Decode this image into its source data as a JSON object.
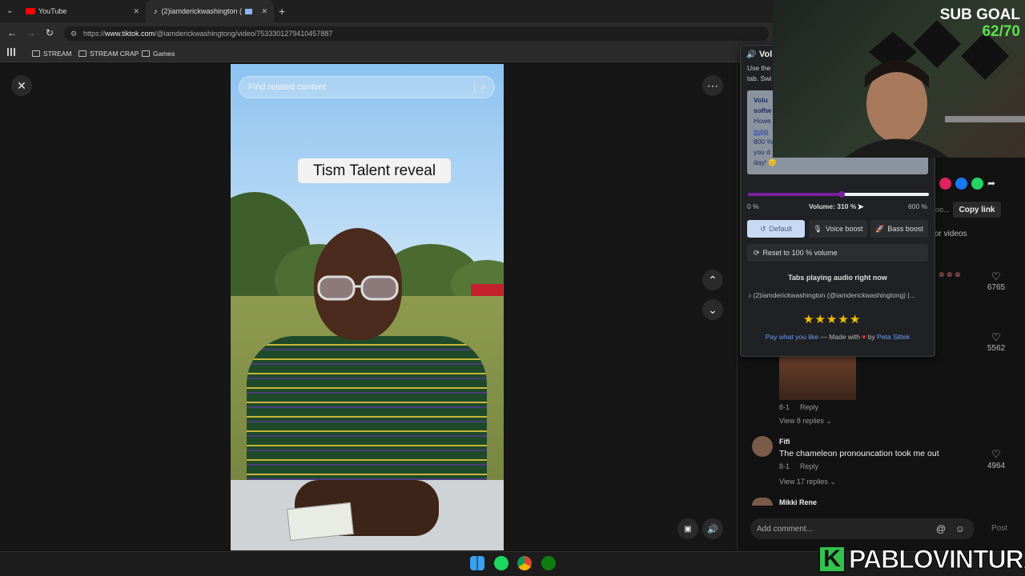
{
  "browser": {
    "tabs": [
      {
        "title": "YouTube"
      },
      {
        "title": "(2)iamderickwashington (@"
      }
    ],
    "url_prefix": "https://",
    "url_domain": "www.tiktok.com",
    "url_path": "/@iamderickwashingtong/video/7533301279410457887",
    "bookmarks": [
      "STREAM",
      "STREAM CRAP",
      "Games"
    ]
  },
  "video": {
    "search_placeholder": "Find related content",
    "caption": "Tism Talent reveal"
  },
  "volume_popup": {
    "title": "Vol",
    "intro_line1": "Use the",
    "intro_line2": "tab. Swi",
    "notice_lines": [
      "Volu",
      "softw",
      "Howe",
      "supp",
      "800 %",
      "you d",
      "day! 😊"
    ],
    "level_min": "0 %",
    "level_max": "600 %",
    "volume_label": "Volume: 310 %",
    "volume_value_pct": 310,
    "volume_max_pct": 600,
    "buttons": {
      "default": "Default",
      "voice": "Voice boost",
      "bass": "Bass boost",
      "reset": "Reset to 100 % volume"
    },
    "tabs_heading": "Tabs playing audio right now",
    "tab_playing": "(2)iamderickwashington (@iamderickwashingtong) |...",
    "rating": 5,
    "footer_link1": "Pay what you like",
    "footer_mid": "— Made with",
    "footer_by": "by",
    "footer_link2": "Peta Sittek"
  },
  "side": {
    "copy_link": "Copy link",
    "creator_videos": "or videos",
    "share_partial": "oo...",
    "comments": [
      {
        "likes": "6765"
      },
      {
        "likes": "5562",
        "meta": "8-1",
        "reply": "Reply",
        "view_replies": "View 8 replies"
      },
      {
        "name": "Fifi",
        "text": "The chameleon pronouncation took me out",
        "meta": "8-1",
        "reply": "Reply",
        "likes": "4964",
        "view_replies": "View 17 replies"
      },
      {
        "name": "Mikki Rene"
      }
    ],
    "add_comment": "Add comment...",
    "post": "Post"
  },
  "overlay": {
    "sub_goal_label": "SUB GOAL",
    "sub_goal_value": "62/70",
    "brand_letter": "K",
    "brand_name": "PABLOVINTURA"
  },
  "colors": {
    "accent_purple": "#7a1fa2",
    "goal_green": "#5be24c",
    "link_blue": "#6b9cff"
  }
}
